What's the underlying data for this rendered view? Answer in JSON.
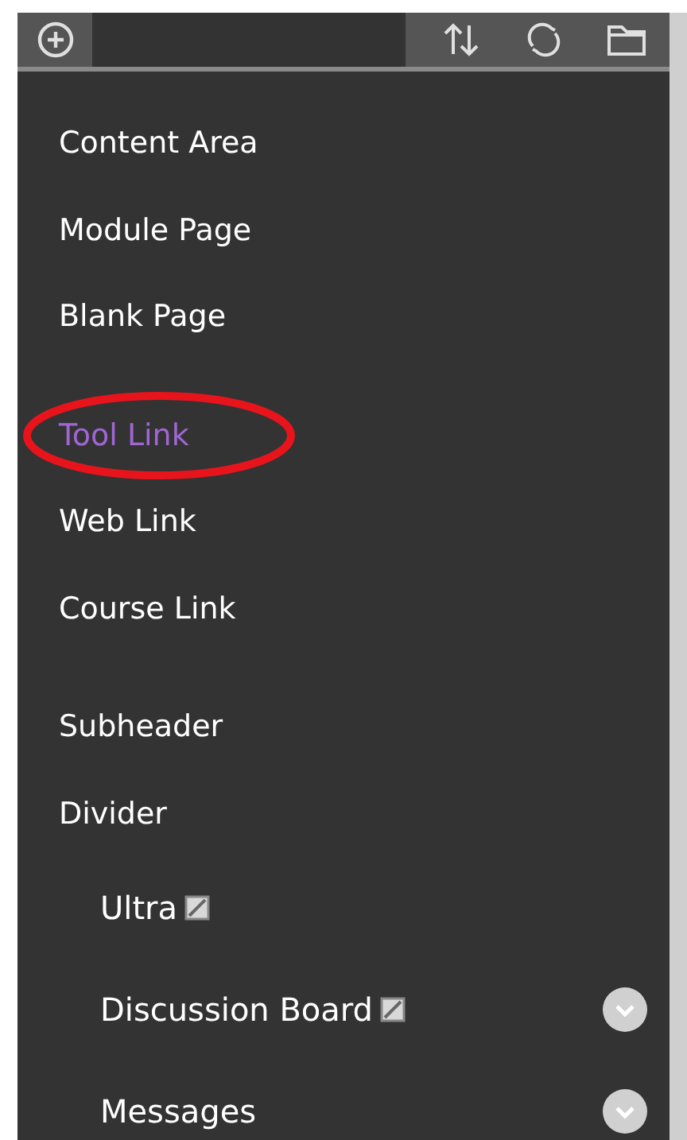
{
  "menu": {
    "groups": [
      {
        "items": [
          {
            "label": "Content Area",
            "selected": false,
            "circled": false
          },
          {
            "label": "Module Page",
            "selected": false,
            "circled": false
          },
          {
            "label": "Blank Page",
            "selected": false,
            "circled": false
          }
        ]
      },
      {
        "items": [
          {
            "label": "Tool Link",
            "selected": true,
            "circled": true
          },
          {
            "label": "Web Link",
            "selected": false,
            "circled": false
          },
          {
            "label": "Course Link",
            "selected": false,
            "circled": false
          }
        ]
      },
      {
        "items": [
          {
            "label": "Subheader",
            "selected": false,
            "circled": false
          },
          {
            "label": "Divider",
            "selected": false,
            "circled": false
          }
        ]
      }
    ]
  },
  "course_menu": [
    {
      "label": "Ultra",
      "hidden_mark": true,
      "has_options": false
    },
    {
      "label": "Discussion Board",
      "hidden_mark": true,
      "has_options": true
    },
    {
      "label": "Messages",
      "hidden_mark": false,
      "has_options": true
    }
  ]
}
